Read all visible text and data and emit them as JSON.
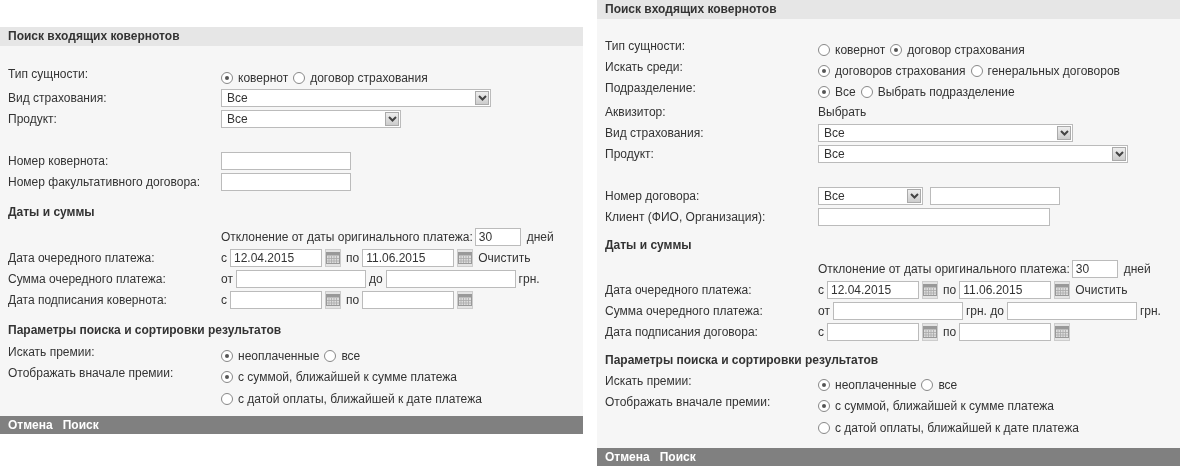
{
  "panels": [
    {
      "title": "Поиск входящих ковернотов",
      "rows": [
        {
          "kind": "radio",
          "label": "Тип сущности:",
          "options": [
            {
              "label": "ковернот",
              "selected": true
            },
            {
              "label": "договор страхования",
              "selected": false
            }
          ]
        },
        {
          "kind": "select",
          "label": "Вид страхования:",
          "value": "Все"
        },
        {
          "kind": "select",
          "label": "Продукт:",
          "value": "Все"
        },
        {
          "kind": "spacer"
        },
        {
          "kind": "input",
          "label": "Номер ковернота:"
        },
        {
          "kind": "input",
          "label": "Номер факультативного договора:"
        },
        {
          "kind": "section",
          "title": "Даты и суммы"
        },
        {
          "kind": "deviation",
          "text": "Отклонение от даты оригинального платежа:",
          "value": "30",
          "unit": "дней"
        },
        {
          "kind": "date-range",
          "label": "Дата очередного платежа:",
          "from_prefix": "с",
          "from_value": "12.04.2015",
          "to_prefix": "по",
          "to_value": "11.06.2015",
          "action": "Очистить"
        },
        {
          "kind": "amount-range",
          "label": "Сумма очередного платежа:",
          "prefix": "от",
          "middle": "до",
          "suffix": "грн."
        },
        {
          "kind": "date-range",
          "label": "Дата подписания ковернота:",
          "from_prefix": "с",
          "to_prefix": "по"
        },
        {
          "kind": "section",
          "title": "Параметры поиска и сортировки результатов"
        },
        {
          "kind": "radio",
          "label": "Искать премии:",
          "options": [
            {
              "label": "неоплаченные",
              "selected": true
            },
            {
              "label": "все",
              "selected": false
            }
          ]
        },
        {
          "kind": "radio-stack",
          "label": "Отображать вначале премии:",
          "options": [
            {
              "label": "с суммой, ближайшей к сумме платежа",
              "selected": true
            },
            {
              "label": "с датой оплаты, ближайшей к дате платежа",
              "selected": false
            }
          ]
        }
      ],
      "footer": [
        "Отмена",
        "Поиск"
      ]
    },
    {
      "title": "Поиск входящих ковернотов",
      "rows": [
        {
          "kind": "radio",
          "label": "Тип сущности:",
          "options": [
            {
              "label": "ковернот",
              "selected": false
            },
            {
              "label": "договор страхования",
              "selected": true
            }
          ]
        },
        {
          "kind": "radio",
          "label": "Искать среди:",
          "options": [
            {
              "label": "договоров страхования",
              "selected": true
            },
            {
              "label": "генеральных договоров",
              "selected": false
            }
          ]
        },
        {
          "kind": "radio",
          "label": "Подразделение:",
          "options": [
            {
              "label": "Все",
              "selected": true
            },
            {
              "label": "Выбрать подразделение",
              "selected": false
            }
          ]
        },
        {
          "kind": "link",
          "label": "Аквизитор:",
          "value": "Выбрать"
        },
        {
          "kind": "select",
          "label": "Вид страхования:",
          "value": "Все"
        },
        {
          "kind": "select",
          "label": "Продукт:",
          "value": "Все"
        },
        {
          "kind": "spacer"
        },
        {
          "kind": "select-input",
          "label": "Номер договора:",
          "value": "Все"
        },
        {
          "kind": "input",
          "label": "Клиент (ФИО, Организация):"
        },
        {
          "kind": "section",
          "title": "Даты и суммы"
        },
        {
          "kind": "deviation",
          "text": "Отклонение от даты оригинального платежа:",
          "value": "30",
          "unit": "дней"
        },
        {
          "kind": "date-range",
          "label": "Дата очередного платежа:",
          "from_prefix": "с",
          "from_value": "12.04.2015",
          "to_prefix": "по",
          "to_value": "11.06.2015",
          "action": "Очистить"
        },
        {
          "kind": "amount-range",
          "label": "Сумма очередного платежа:",
          "prefix": "от",
          "middle": "грн. до",
          "suffix": "грн."
        },
        {
          "kind": "date-range",
          "label": "Дата подписания договора:",
          "from_prefix": "с",
          "to_prefix": "по"
        },
        {
          "kind": "section",
          "title": "Параметры поиска и сортировки результатов"
        },
        {
          "kind": "radio",
          "label": "Искать премии:",
          "options": [
            {
              "label": "неоплаченные",
              "selected": true
            },
            {
              "label": "все",
              "selected": false
            }
          ]
        },
        {
          "kind": "radio-stack",
          "label": "Отображать вначале премии:",
          "options": [
            {
              "label": "с суммой, ближайшей к сумме платежа",
              "selected": true
            },
            {
              "label": "с датой оплаты, ближайшей к дате платежа",
              "selected": false
            }
          ]
        }
      ],
      "footer": [
        "Отмена",
        "Поиск"
      ]
    }
  ]
}
